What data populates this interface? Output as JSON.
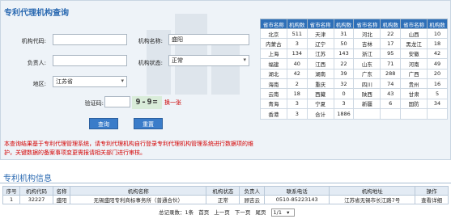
{
  "search": {
    "title": "专利代理机构查询",
    "code_label": "机构代码:",
    "code_value": "",
    "name_label": "机构名称:",
    "name_value": "盛阳",
    "principal_label": "负责人:",
    "principal_value": "",
    "status_label": "机构状态:",
    "status_value": "正常",
    "region_label": "地区:",
    "region_value": "江苏省",
    "captcha_label": "验证码:",
    "captcha_value": "",
    "captcha_image_text": "9-9=",
    "refresh_label": "换一张",
    "query_button": "查询",
    "reset_button": "重置",
    "notice_line1": "本查询结果基于专利代理管理系统，请专利代理机构自行登录专利代理机构管理系统进行数据项的维",
    "notice_line2": "护，关键数据的备案事项变更需报请相关部门进行审核。"
  },
  "stats": {
    "headers": [
      "省市名称",
      "机构数",
      "省市名称",
      "机构数",
      "省市名称",
      "机构数",
      "省市名称",
      "机构数"
    ],
    "rows": [
      [
        "北京",
        "511",
        "天津",
        "31",
        "河北",
        "22",
        "山西",
        "10"
      ],
      [
        "内蒙古",
        "3",
        "辽宁",
        "50",
        "吉林",
        "17",
        "黑龙江",
        "18"
      ],
      [
        "上海",
        "134",
        "江苏",
        "143",
        "浙江",
        "95",
        "安徽",
        "42"
      ],
      [
        "福建",
        "40",
        "江西",
        "22",
        "山东",
        "71",
        "河南",
        "49"
      ],
      [
        "湖北",
        "42",
        "湖南",
        "39",
        "广东",
        "288",
        "广西",
        "20"
      ],
      [
        "海南",
        "2",
        "重庆",
        "32",
        "四川",
        "74",
        "贵州",
        "16"
      ],
      [
        "云南",
        "18",
        "西藏",
        "0",
        "陕西",
        "43",
        "甘肃",
        "5"
      ],
      [
        "青海",
        "3",
        "宁夏",
        "3",
        "新疆",
        "6",
        "国防",
        "34"
      ],
      [
        "香港",
        "3",
        "合计",
        "1886",
        "",
        "",
        "",
        ""
      ]
    ]
  },
  "results": {
    "section_title": "专利机构信息",
    "headers": [
      "序号",
      "机构代码",
      "名称",
      "机构名称",
      "机构状态",
      "负责人",
      "联系电话",
      "机构地址",
      "操作"
    ],
    "rows": [
      [
        "1",
        "32227",
        "盛阳",
        "无锡盛阳专利商标事务所（普通合伙）",
        "正常",
        "顾吉云",
        "0510-85223143",
        "江苏省无锡市长江路7号",
        "查看详细"
      ]
    ]
  },
  "pager": {
    "total": "总记录数：1条",
    "first": "首页",
    "prev": "上一页",
    "next": "下一页",
    "last": "尾页",
    "page": "1/1"
  }
}
